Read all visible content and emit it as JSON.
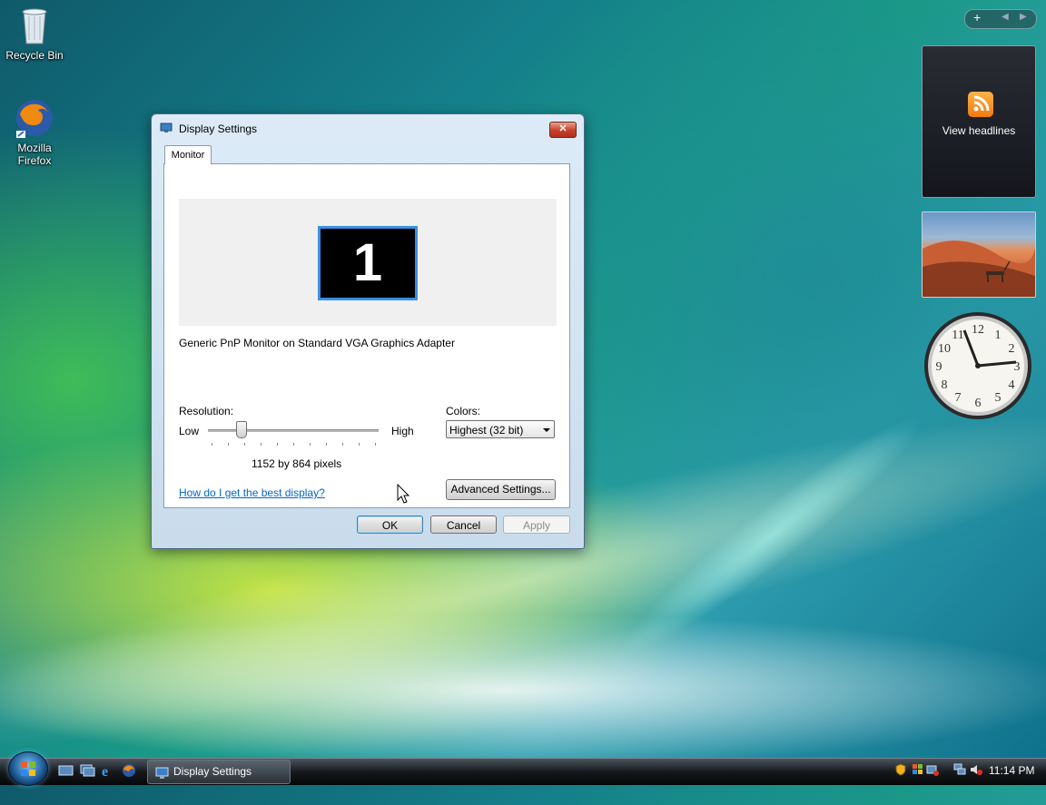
{
  "desktop": {
    "icons": [
      {
        "label": "Recycle Bin",
        "icon": "recycle-bin-icon"
      },
      {
        "label": "Mozilla Firefox",
        "icon": "firefox-icon"
      }
    ]
  },
  "dialog": {
    "title": "Display Settings",
    "close_label": "✕",
    "tab_label": "Monitor",
    "monitor_number": "1",
    "monitor_name": "Generic PnP Monitor on Standard VGA Graphics Adapter",
    "resolution_label": "Resolution:",
    "low_label": "Low",
    "high_label": "High",
    "resolution_value": "1152 by 864 pixels",
    "resolution_slider_fraction": 0.19,
    "colors_label": "Colors:",
    "colors_selected": "Highest (32 bit)",
    "help_link": "How do I get the best display?",
    "advanced_button": "Advanced Settings...",
    "ok_button": "OK",
    "cancel_button": "Cancel",
    "apply_button": "Apply"
  },
  "gadgets": {
    "feed_text": "View headlines",
    "clock_icon": "clock-icon",
    "slideshow_icon": "slideshow-image"
  },
  "taskbar": {
    "task_label": "Display Settings",
    "time": "11:14 PM"
  },
  "colors": {
    "accent": "#3a8fe4",
    "link": "#0066cc",
    "close": "#c8412a"
  }
}
